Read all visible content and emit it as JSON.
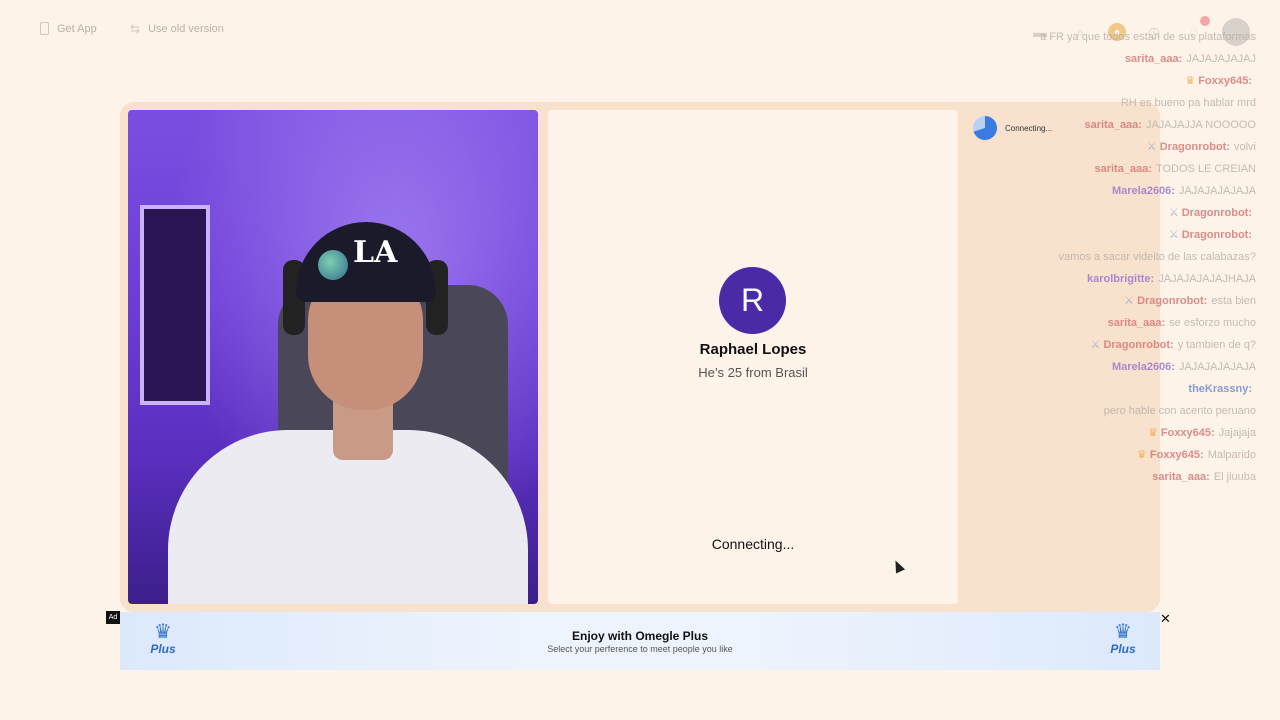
{
  "topbar": {
    "get_app": "Get App",
    "use_old": "Use old version",
    "icons": [
      "gift-icon",
      "search-icon",
      "coin-icon",
      "history-icon",
      "messages-icon",
      "avatar"
    ]
  },
  "stranger": {
    "initial": "R",
    "name": "Raphael Lopes",
    "info": "He’s 25 from Brasil",
    "status": "Connecting..."
  },
  "chat": {
    "status": "Connecting...",
    "messages": [
      {
        "user": "",
        "text": "a FR ya que todos estan de sus plataformas",
        "mark": ""
      },
      {
        "user": "sarita_aaa:",
        "text": "JAJAJAJAJAJ",
        "mark": ""
      },
      {
        "user": "Foxxy645:",
        "text": "",
        "mark": "crown"
      },
      {
        "user": "",
        "text": "RH es bueno pa hablar mrd",
        "mark": ""
      },
      {
        "user": "sarita_aaa:",
        "text": "JAJAJAJJA NOOOOO",
        "mark": ""
      },
      {
        "user": "Dragonrobot:",
        "text": "volvi",
        "mark": "sword"
      },
      {
        "user": "sarita_aaa:",
        "text": "TODOS LE CREIAN",
        "mark": ""
      },
      {
        "user": "Marela2606:",
        "text": "JAJAJAJAJAJA",
        "mark": ""
      },
      {
        "user": "Dragonrobot:",
        "text": "",
        "mark": "sword"
      },
      {
        "user": "Dragonrobot:",
        "text": "",
        "mark": "sword"
      },
      {
        "user": "",
        "text": "vamos a sacar videito de las calabazas?",
        "mark": ""
      },
      {
        "user": "karolbrigitte:",
        "text": "JAJAJAJAJAJHAJA",
        "mark": ""
      },
      {
        "user": "Dragonrobot:",
        "text": "esta bien",
        "mark": "sword"
      },
      {
        "user": "sarita_aaa:",
        "text": "se esforzo mucho",
        "mark": ""
      },
      {
        "user": "Dragonrobot:",
        "text": "y tambien de q?",
        "mark": "sword"
      },
      {
        "user": "Marela2606:",
        "text": "JAJAJAJAJAJA",
        "mark": ""
      },
      {
        "user": "theKrassny:",
        "text": "",
        "mark": ""
      },
      {
        "user": "",
        "text": "pero hable con acento peruano",
        "mark": ""
      },
      {
        "user": "Foxxy645:",
        "text": "Jajajaja",
        "mark": "crown"
      },
      {
        "user": "Foxxy645:",
        "text": "Malparido",
        "mark": "crown"
      },
      {
        "user": "sarita_aaa:",
        "text": "El jiuuba",
        "mark": ""
      }
    ]
  },
  "ad": {
    "tag": "Ad",
    "title": "Enjoy with Omegle Plus",
    "subtitle": "Select your perference to meet people you like",
    "plus_label": "Plus",
    "close": "✕"
  }
}
